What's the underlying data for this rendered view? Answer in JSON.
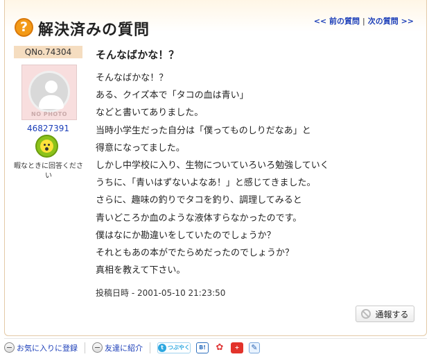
{
  "header": {
    "icon": "question-icon",
    "icon_glyph": "?",
    "title": "解決済みの質問",
    "prev_link": "<< 前の質問",
    "separator": "|",
    "next_link": "次の質問 >>"
  },
  "user": {
    "question_no": "QNo.74304",
    "avatar_label": "NO PHOTO",
    "user_id": "46827391",
    "status_icon": "surprised-face-icon",
    "status_text": "暇なときに回答ください"
  },
  "question": {
    "title": "そんなばかな！？",
    "body": [
      "そんなばかな！？",
      "ある、クイズ本で「タコの血は青い」",
      "などと書いてありました。",
      "当時小学生だった自分は「僕ってものしりだなあ」と",
      "得意になってました。",
      "しかし中学校に入り、生物についていろいろ勉強していく",
      "うちに、「青いはずないよなあ！」と感じてきました。",
      "さらに、趣味の釣りでタコを釣り、調理してみると",
      "青いどころか血のような液体すらなかったのです。",
      "僕はなにか勘違いをしていたのでしょうか？",
      "それともあの本がでたらめだったのでしょうか？",
      "真相を教えて下さい。"
    ],
    "posted_label": "投稿日時 - 2001-05-10 21:23:50"
  },
  "actions": {
    "report_label": "通報する",
    "report_icon": "no-entry-icon"
  },
  "footer": {
    "favorite_label": "お気に入りに登録",
    "favorite_icon": "minus-circle-icon",
    "share_friend_label": "友達に紹介",
    "share_friend_icon": "minus-circle-icon",
    "twitter_label": "つぶやく",
    "twitter_icon": "twitter-icon",
    "hatena_label": "B!",
    "hatena_icon": "hatena-bookmark-icon",
    "livedoor_icon": "livedoor-clip-icon",
    "google_icon": "google-bookmark-icon",
    "google_label": "+",
    "memo_icon": "pencil-icon",
    "memo_glyph": "✎"
  }
}
